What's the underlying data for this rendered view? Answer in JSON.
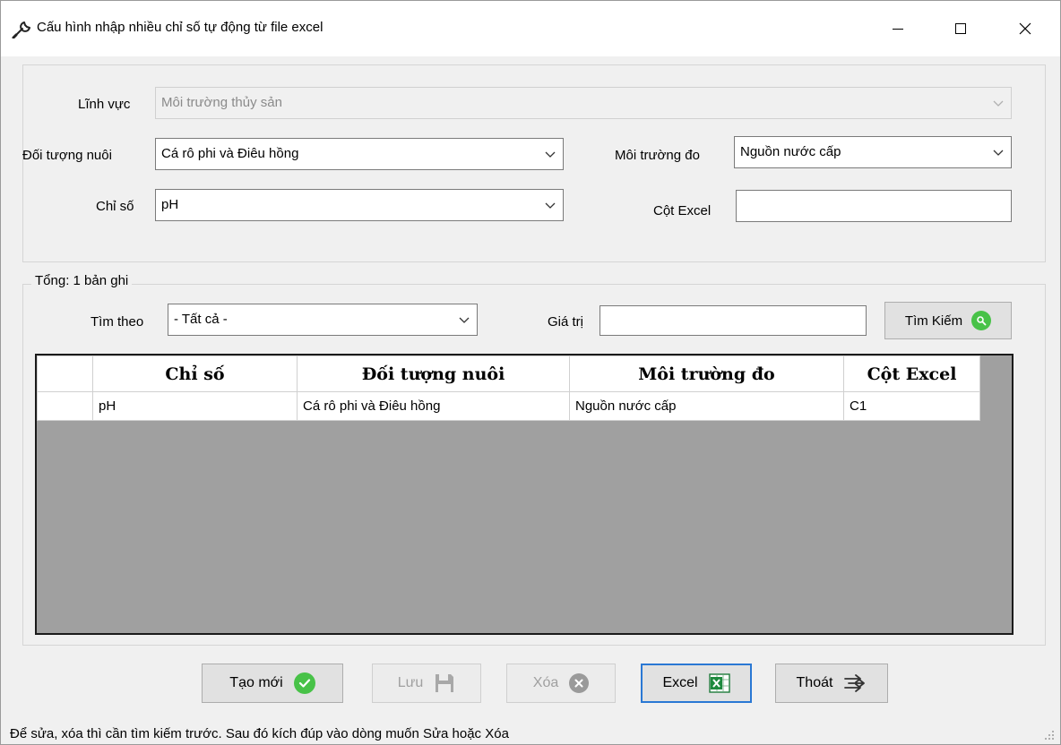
{
  "window": {
    "title": "Cấu hình nhập nhiều chỉ số tự động từ file excel"
  },
  "form": {
    "linh_vuc": {
      "label": "Lĩnh vực",
      "value": "Môi trường thủy sản"
    },
    "doi_tuong_nuoi": {
      "label": "Đối tượng nuôi",
      "value": "Cá rô phi và Điêu hồng"
    },
    "moi_truong_do": {
      "label": "Môi trường đo",
      "value": "Nguồn nước cấp"
    },
    "chi_so": {
      "label": "Chỉ số",
      "value": "pH"
    },
    "cot_excel": {
      "label": "Cột Excel",
      "value": ""
    }
  },
  "search": {
    "total_label": "Tổng: 1 bản ghi",
    "tim_theo_label": "Tìm theo",
    "tim_theo_value": "- Tất cả -",
    "gia_tri_label": "Giá trị",
    "gia_tri_value": "",
    "button_label": "Tìm Kiếm"
  },
  "grid": {
    "columns": [
      "Chỉ số",
      "Đối tượng nuôi",
      "Môi trường đo",
      "Cột Excel"
    ],
    "rows": [
      [
        "pH",
        "Cá rô phi và Điêu hồng",
        "Nguồn nước cấp",
        "C1"
      ]
    ]
  },
  "actions": {
    "new_label": "Tạo mới",
    "save_label": "Lưu",
    "delete_label": "Xóa",
    "excel_label": "Excel",
    "exit_label": "Thoát"
  },
  "status": {
    "text": "Để sửa, xóa thì cần tìm kiếm trước. Sau đó kích đúp vào dòng muốn Sửa hoặc Xóa"
  },
  "icons": {
    "title": "wrench-icon",
    "search": "magnifier-icon",
    "new": "check-circle-icon",
    "save": "floppy-disk-icon",
    "delete": "x-circle-icon",
    "excel": "excel-icon",
    "exit": "exit-arrow-icon"
  },
  "colors": {
    "accent_green": "#48c248",
    "focus_blue": "#2a78d4",
    "grid_bg": "#a0a0a0"
  }
}
